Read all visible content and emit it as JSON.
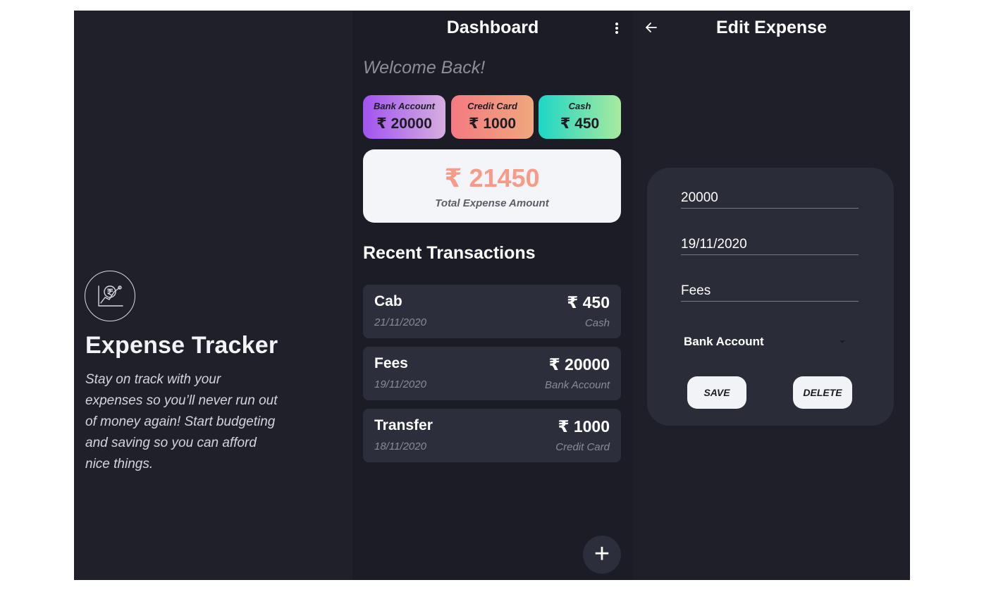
{
  "intro": {
    "title": "Expense Tracker",
    "description": "Stay on track with your expenses so you’ll never run out of money again! Start budgeting and saving so you can afford nice things."
  },
  "dashboard": {
    "title": "Dashboard",
    "welcome": "Welcome Back!",
    "accounts": [
      {
        "label": "Bank Account",
        "amount": "₹ 20000"
      },
      {
        "label": "Credit Card",
        "amount": "₹ 1000"
      },
      {
        "label": "Cash",
        "amount": "₹ 450"
      }
    ],
    "total": {
      "amount": "₹ 21450",
      "label": "Total Expense Amount"
    },
    "recent_title": "Recent Transactions",
    "transactions": [
      {
        "name": "Cab",
        "date": "21/11/2020",
        "amount": "₹ 450",
        "account": "Cash"
      },
      {
        "name": "Fees",
        "date": "19/11/2020",
        "amount": "₹ 20000",
        "account": "Bank Account"
      },
      {
        "name": "Transfer",
        "date": "18/11/2020",
        "amount": "₹ 1000",
        "account": "Credit Card"
      }
    ],
    "fab_label": "+"
  },
  "edit": {
    "title": "Edit Expense",
    "amount_value": "20000",
    "date_value": "19/11/2020",
    "note_value": "Fees",
    "account_selected": "Bank Account",
    "save_label": "SAVE",
    "delete_label": "DELETE"
  },
  "colors": {
    "background": "#1e1f29",
    "card": "#2c2e3b",
    "total_amount": "#f89a88",
    "bank_gradient": [
      "#a153f0",
      "#d6aee0"
    ],
    "credit_gradient": [
      "#f47a82",
      "#f0a77e"
    ],
    "cash_gradient": [
      "#1ed6c6",
      "#a9ea9f"
    ]
  },
  "icons": {
    "logo": "rupee-chart-icon",
    "menu": "kebab-menu-icon",
    "back": "back-arrow-icon",
    "add": "plus-icon",
    "dropdown": "caret-down-icon"
  }
}
